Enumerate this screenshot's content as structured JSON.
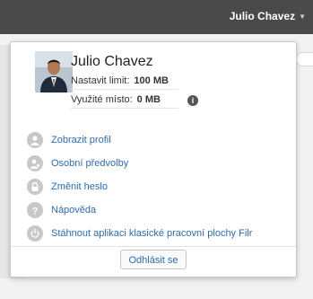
{
  "header": {
    "user_name": "Julio Chavez"
  },
  "profile": {
    "name": "Julio Chavez",
    "quota_label": "Nastavit limit:",
    "quota_value": "100 MB",
    "used_label": "Využité místo:",
    "used_value": "0 MB",
    "info_badge": "i"
  },
  "menu": {
    "items": [
      {
        "label": "Zobrazit profil",
        "icon": "person-icon"
      },
      {
        "label": "Osobní předvolby",
        "icon": "person-gear-icon"
      },
      {
        "label": "Změnit heslo",
        "icon": "lock-icon"
      },
      {
        "label": "Nápověda",
        "icon": "help-icon"
      },
      {
        "label": "Stáhnout aplikaci klasické pracovní plochy Filr",
        "icon": "power-icon"
      }
    ]
  },
  "footer": {
    "logout_label": "Odhlásit se"
  },
  "colors": {
    "link": "#2b6cb8",
    "topbar": "#4a4a4a",
    "icon_gray": "#c8c8c8"
  }
}
